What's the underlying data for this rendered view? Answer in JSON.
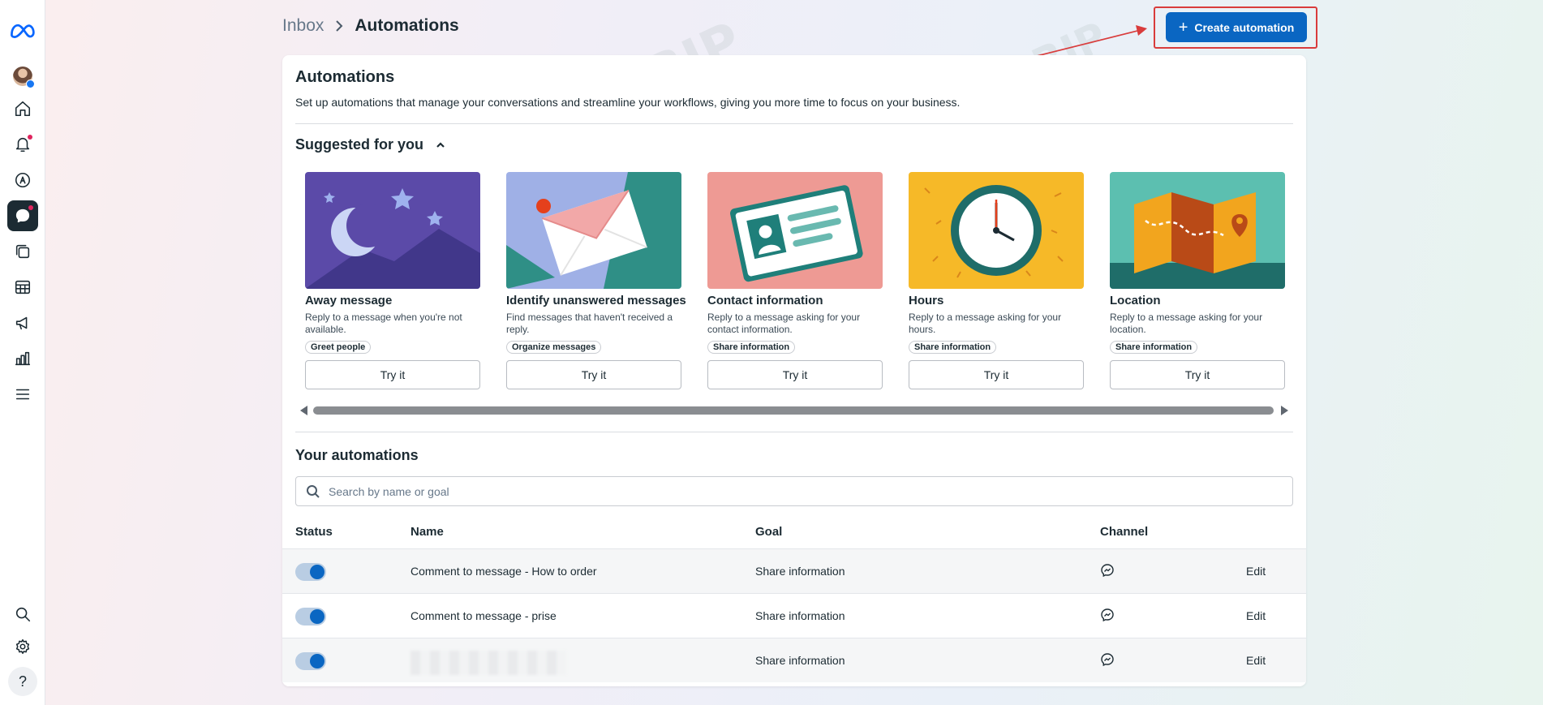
{
  "nav": {
    "items": [
      "meta-logo",
      "profile",
      "home",
      "notifications",
      "ads-manager",
      "inbox",
      "content",
      "planner",
      "ads",
      "insights",
      "menu",
      "search",
      "settings",
      "help"
    ],
    "help_glyph": "?"
  },
  "header": {
    "breadcrumb_parent": "Inbox",
    "breadcrumb_current": "Automations",
    "create_button": "Create automation",
    "create_plus": "+"
  },
  "intro": {
    "title": "Automations",
    "subtitle": "Set up automations that manage your conversations and streamline your workflows, giving you more time to focus on your business."
  },
  "suggested": {
    "title": "Suggested for you",
    "cards": [
      {
        "title": "Away message",
        "desc": "Reply to a message when you're not available.",
        "tag": "Greet people",
        "button": "Try it"
      },
      {
        "title": "Identify unanswered messages",
        "desc": "Find messages that haven't received a reply.",
        "tag": "Organize messages",
        "button": "Try it"
      },
      {
        "title": "Contact information",
        "desc": "Reply to a message asking for your contact information.",
        "tag": "Share information",
        "button": "Try it"
      },
      {
        "title": "Hours",
        "desc": "Reply to a message asking for your hours.",
        "tag": "Share information",
        "button": "Try it"
      },
      {
        "title": "Location",
        "desc": "Reply to a message asking for your location.",
        "tag": "Share information",
        "button": "Try it"
      }
    ]
  },
  "automations": {
    "title": "Your automations",
    "search_placeholder": "Search by name or goal",
    "columns": {
      "status": "Status",
      "name": "Name",
      "goal": "Goal",
      "channel": "Channel"
    },
    "rows": [
      {
        "name": "Comment to message - How to order",
        "goal": "Share information",
        "channel": "messenger-icon",
        "enabled": true,
        "edit": "Edit"
      },
      {
        "name": "Comment to message - prise",
        "goal": "Share information",
        "channel": "messenger-icon",
        "enabled": true,
        "edit": "Edit"
      },
      {
        "name": "",
        "goal": "Share information",
        "channel": "messenger-icon",
        "enabled": true,
        "edit": "Edit"
      }
    ]
  },
  "watermark": "CPA.RIP",
  "colors": {
    "primary": "#0a66c2",
    "highlight": "#d93c3c",
    "text": "#1c2b33"
  }
}
